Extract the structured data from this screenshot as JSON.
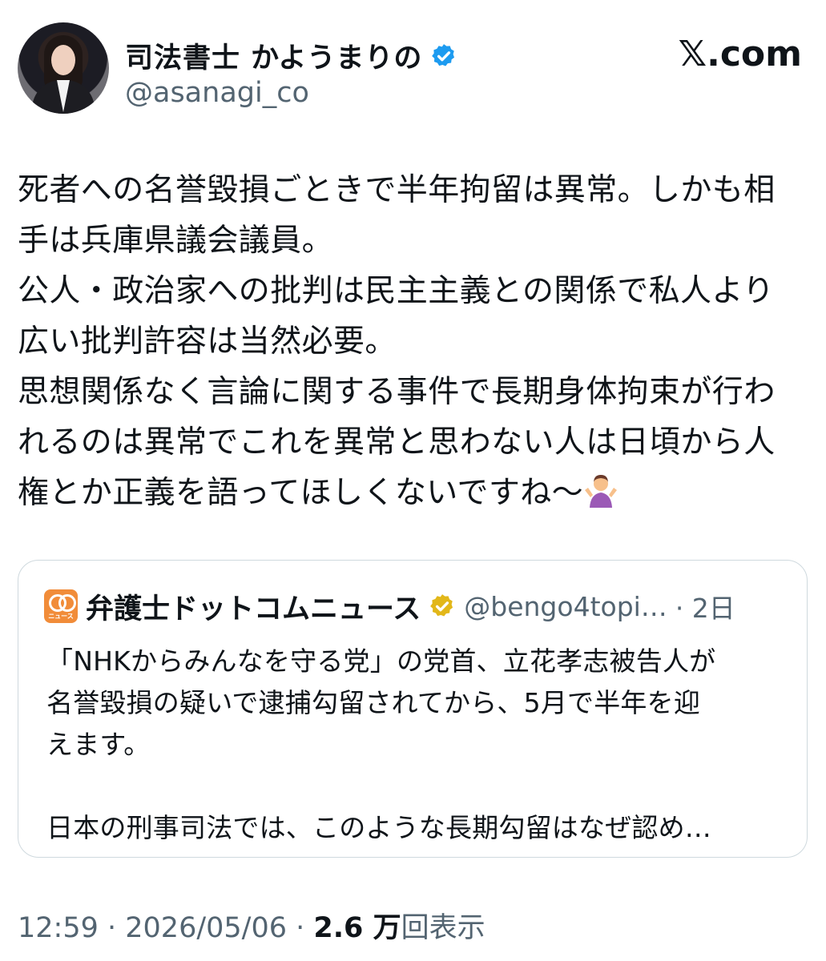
{
  "author": {
    "display_name": "司法書士 かようまりの",
    "handle": "@asanagi_co",
    "verified_color": "#1d9bf0"
  },
  "brand": {
    "site": "𝕏.com"
  },
  "tweet": {
    "text": "死者への名誉毀損ごときで半年拘留は異常。しかも相\n手は兵庫県議会議員。\n公人・政治家への批判は民主主義との関係で私人より\n広い批判許容は当然必要。\n思想関係なく言論に関する事件で長期身体拘束が行わ\nれるのは異常でこれを異常と思わない人は日頃から人\n権とか正義を語ってほしくないですね〜",
    "emoji": "person-shrugging-emoji"
  },
  "quote": {
    "display_name": "弁護士ドットコムニュース",
    "handle": "@bengo4topi…",
    "time": "· 2日",
    "logo_text": "ニュース",
    "badge_color": "#e2b719",
    "text": "「NHKからみんなを守る党」の党首、立花孝志被告人が\n名誉毀損の疑いで逮捕勾留されてから、5月で半年を迎\nえます。\n\n日本の刑事司法では、このような長期勾留はなぜ認め…"
  },
  "meta": {
    "time": "12:59",
    "sep1": " · ",
    "date": "2026/05/06",
    "sep2": " · ",
    "views": "2.6 万",
    "views_label": "回表示"
  }
}
